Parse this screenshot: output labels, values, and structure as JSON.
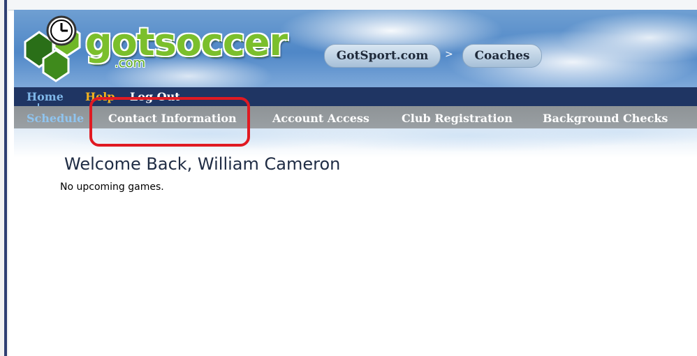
{
  "brand": {
    "logo_text": "gotsoccer",
    "logo_subtext": ".com",
    "colors": {
      "logo_green": "#7bbf2c",
      "nav_dark": "#1f3563",
      "nav_gray": "#9aa0a4",
      "highlight_red": "#e01a22"
    }
  },
  "breadcrumb": {
    "items": [
      "GotSport.com",
      "Coaches"
    ],
    "separator": ">"
  },
  "top_nav": {
    "home": "Home",
    "help": "Help",
    "logout": "Log Out"
  },
  "sub_nav": {
    "items": [
      "Schedule",
      "Contact Information",
      "Account Access",
      "Club Registration",
      "Background Checks"
    ],
    "active": "Schedule",
    "highlighted": "Contact Information"
  },
  "main": {
    "welcome": "Welcome Back, William Cameron",
    "message": "No upcoming games."
  },
  "icons": [
    "clock-icon",
    "soccer-ball-logo-icon"
  ]
}
